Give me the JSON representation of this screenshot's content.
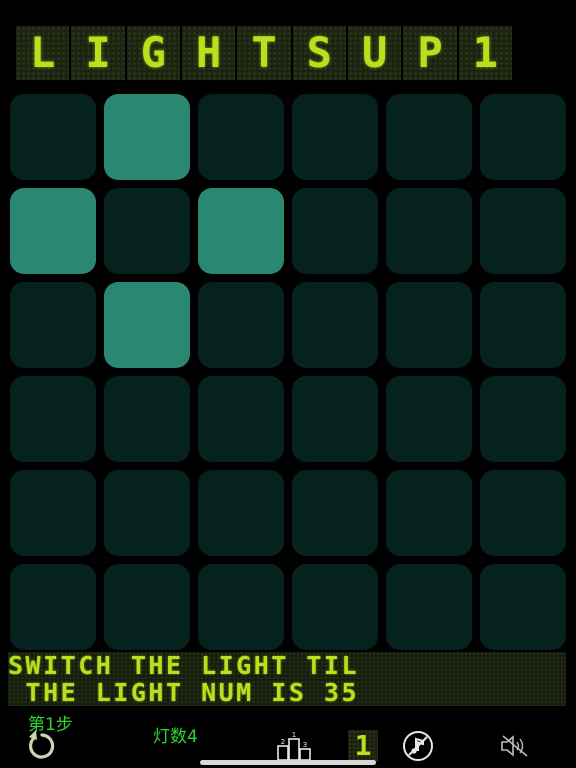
{
  "title": {
    "letters": [
      "L",
      "I",
      "G",
      "H",
      "T",
      "S",
      "U",
      "P",
      "1"
    ],
    "color": "#b8e01c"
  },
  "grid": {
    "rows": 6,
    "cols": 6,
    "on_color": "#2a8772",
    "off_color": "#06221f",
    "cells": [
      [
        0,
        1,
        0,
        0,
        0,
        0
      ],
      [
        1,
        0,
        1,
        0,
        0,
        0
      ],
      [
        0,
        1,
        0,
        0,
        0,
        0
      ],
      [
        0,
        0,
        0,
        0,
        0,
        0
      ],
      [
        0,
        0,
        0,
        0,
        0,
        0
      ],
      [
        0,
        0,
        0,
        0,
        0,
        0
      ]
    ]
  },
  "message": {
    "line1": "SWITCH THE LIGHT TIL",
    "line2": " THE LIGHT NUM IS 35"
  },
  "toolbar": {
    "step_label": "第1步",
    "lights_label": "灯数4",
    "level": "1",
    "icons": {
      "undo": "undo-icon",
      "leaderboard": "podium-icon",
      "music": "music-off-icon",
      "sound": "sound-off-icon"
    }
  }
}
